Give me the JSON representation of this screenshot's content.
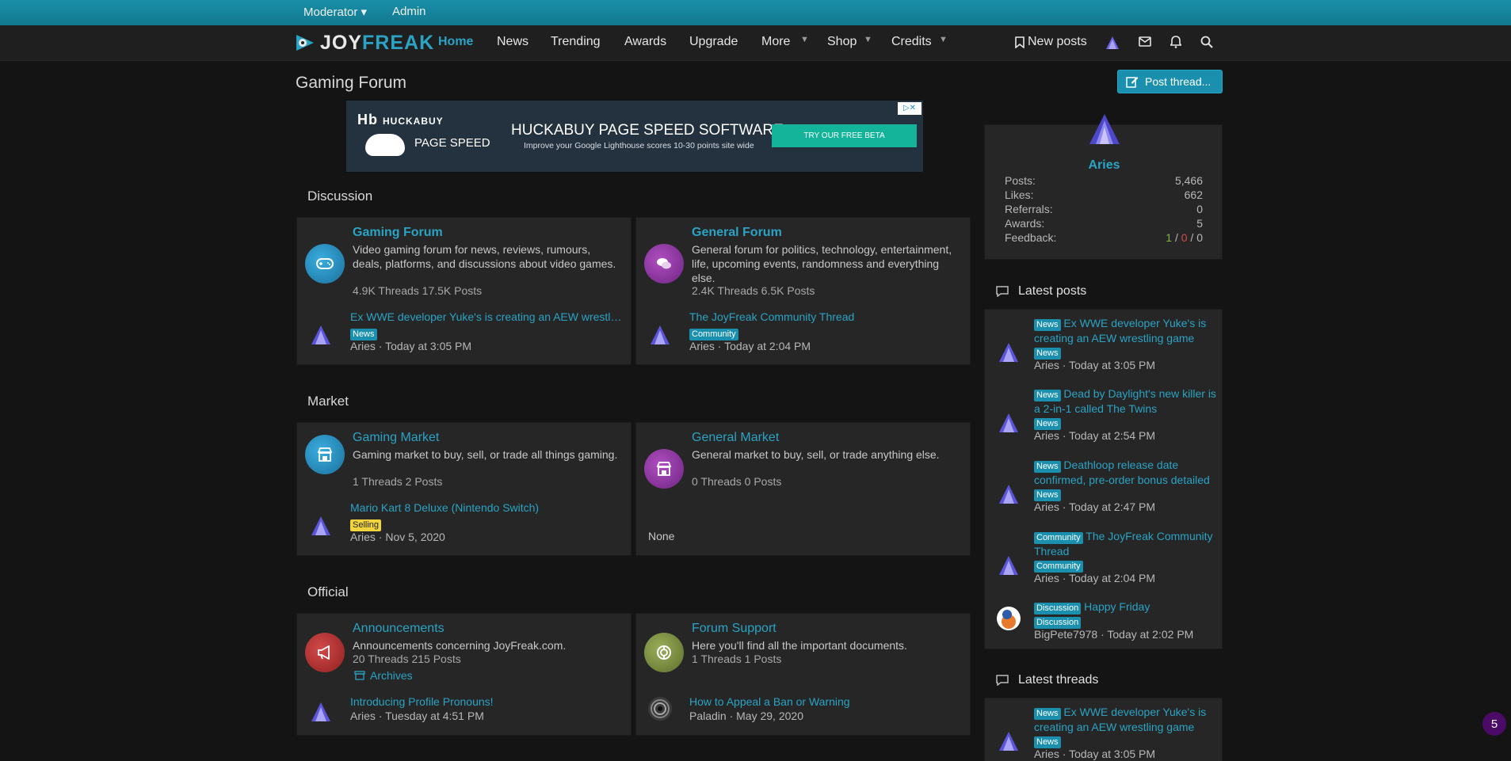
{
  "topbar": {
    "moderator": "Moderator ▾",
    "admin": "Admin"
  },
  "logo": {
    "joy": "JOY",
    "freak": "FREAK"
  },
  "nav": {
    "home": "Home",
    "news": "News",
    "trending": "Trending",
    "awards": "Awards",
    "upgrade": "Upgrade",
    "more": "More",
    "shop": "Shop",
    "credits": "Credits",
    "new_posts": "New posts"
  },
  "page": {
    "title": "Gaming Forum",
    "post_thread": "Post thread..."
  },
  "ad": {
    "brand": "HUCKABUY",
    "sub": "PAGE SPEED",
    "headline": "HUCKABUY PAGE SPEED SOFTWARE",
    "tagline": "Improve your Google Lighthouse scores 10-30 points site wide",
    "cta": "TRY OUR FREE BETA"
  },
  "sections": {
    "discussion": "Discussion",
    "market": "Market",
    "official": "Official"
  },
  "forums": {
    "gaming_forum": {
      "title": "Gaming Forum",
      "desc": "Video gaming forum for news, reviews, rumours, deals, platforms, and discussions about video games.",
      "stats": "4.9K Threads 17.5K Posts",
      "last_title": "Ex WWE developer Yuke's is creating an AEW wrestling game",
      "last_badge": "News",
      "last_meta": "Aries · Today at 3:05 PM"
    },
    "general_forum": {
      "title": "General Forum",
      "desc": "General forum for politics, technology, entertainment, life, upcoming events, randomness and everything else.",
      "stats": "2.4K Threads 6.5K Posts",
      "last_title": "The JoyFreak Community Thread",
      "last_badge": "Community",
      "last_meta": "Aries · Today at 2:04 PM"
    },
    "gaming_market": {
      "title": "Gaming Market",
      "desc": "Gaming market to buy, sell, or trade all things gaming.",
      "stats": "1 Threads 2 Posts",
      "last_title": "Mario Kart 8 Deluxe (Nintendo Switch)",
      "last_badge": "Selling",
      "last_meta": "Aries · Nov 5, 2020"
    },
    "general_market": {
      "title": "General Market",
      "desc": "General market to buy, sell, or trade anything else.",
      "stats": "0 Threads 0 Posts",
      "last_none": "None"
    },
    "announcements": {
      "title": "Announcements",
      "desc": "Announcements concerning JoyFreak.com.",
      "stats": "20 Threads 215 Posts",
      "sub_forum": "Archives",
      "last_title": "Introducing Profile Pronouns!",
      "last_meta": "Aries · Tuesday at 4:51 PM"
    },
    "forum_support": {
      "title": "Forum Support",
      "desc": "Here you'll find all the important documents.",
      "stats": "1 Threads 1 Posts",
      "last_title": "How to Appeal a Ban or Warning",
      "last_meta": "Paladin · May 29, 2020"
    }
  },
  "profile": {
    "name": "Aries",
    "rows": [
      {
        "label": "Posts:",
        "value": "5,466"
      },
      {
        "label": "Likes:",
        "value": "662"
      },
      {
        "label": "Referrals:",
        "value": "0"
      },
      {
        "label": "Awards:",
        "value": "5"
      }
    ],
    "feedback_label": "Feedback:",
    "feedback_pos": "1",
    "feedback_neg": "0",
    "feedback_neu": "0",
    "sep": " / "
  },
  "latest_posts": {
    "heading": "Latest posts",
    "items": [
      {
        "prefix": "News",
        "title": "Ex WWE developer Yuke's is creating an AEW wrestling game",
        "badge": "News",
        "meta": "Aries · Today at 3:05 PM"
      },
      {
        "prefix": "News",
        "title": "Dead by Daylight's new killer is a 2-in-1 called The Twins",
        "badge": "News",
        "meta": "Aries · Today at 2:54 PM"
      },
      {
        "prefix": "News",
        "title": "Deathloop release date confirmed, pre-order bonus detailed",
        "badge": "News",
        "meta": "Aries · Today at 2:47 PM"
      },
      {
        "prefix": "Community",
        "title": "The JoyFreak Community Thread",
        "badge": "Community",
        "meta": "Aries · Today at 2:04 PM"
      },
      {
        "prefix": "Discussion",
        "title": "Happy Friday",
        "badge": "Discussion",
        "meta": "BigPete7978 · Today at 2:02 PM"
      }
    ]
  },
  "latest_threads": {
    "heading": "Latest threads",
    "items": [
      {
        "prefix": "News",
        "title": "Ex WWE developer Yuke's is creating an AEW wrestling game",
        "badge": "News",
        "meta": "Aries · Today at 3:05 PM"
      }
    ]
  },
  "notification_count": "5",
  "colors": {
    "accent": "#2aa3c4",
    "topbar": "#1a8fa8",
    "badge": "#1b8fae",
    "selling": "#f2d53c"
  }
}
